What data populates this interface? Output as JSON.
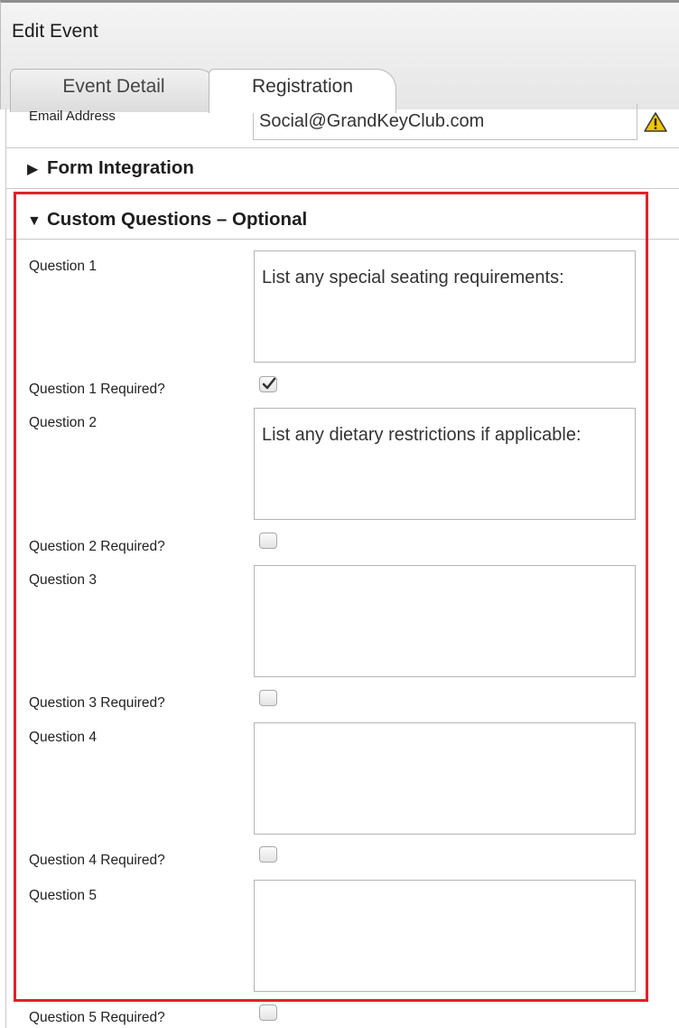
{
  "window": {
    "title": "Edit Event"
  },
  "tabs": [
    {
      "label": "Event Detail",
      "active": false
    },
    {
      "label": "Registration",
      "active": true
    }
  ],
  "email": {
    "label": "Email Address",
    "value": "Social@GrandKeyClub.com",
    "status_icon": "warning-icon"
  },
  "sections": {
    "form_integration": {
      "title": "Form Integration",
      "expanded": false
    },
    "custom_questions": {
      "title": "Custom Questions – Optional",
      "expanded": true
    }
  },
  "questions": [
    {
      "label": "Question 1",
      "value": "List any special seating requirements:",
      "required_label": "Question 1 Required?",
      "required": true
    },
    {
      "label": "Question 2",
      "value": "List any dietary restrictions if applicable:",
      "required_label": "Question 2 Required?",
      "required": false
    },
    {
      "label": "Question 3",
      "value": "",
      "required_label": "Question 3 Required?",
      "required": false
    },
    {
      "label": "Question 4",
      "value": "",
      "required_label": "Question 4 Required?",
      "required": false
    },
    {
      "label": "Question 5",
      "value": "",
      "required_label": "Question 5 Required?",
      "required": false
    }
  ],
  "colors": {
    "highlight": "#e0212a",
    "warning": "#f2c500"
  }
}
